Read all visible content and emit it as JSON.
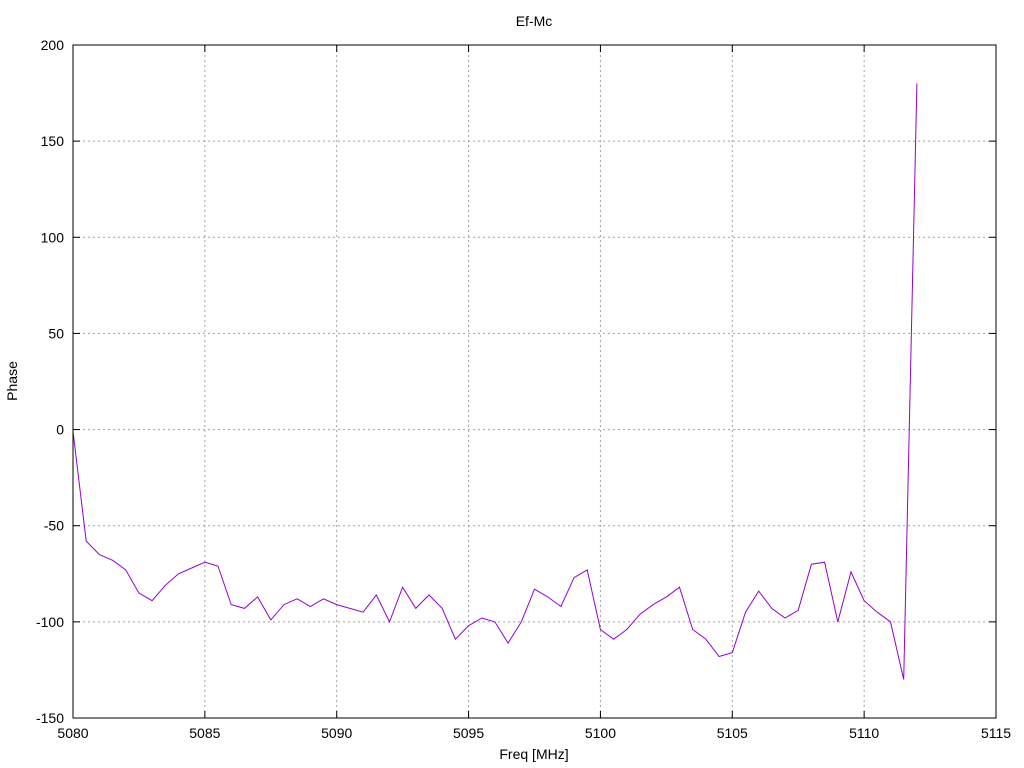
{
  "chart_data": {
    "type": "line",
    "title": "Ef-Mc",
    "xlabel": "Freq [MHz]",
    "ylabel": "Phase",
    "xlim": [
      5080,
      5115
    ],
    "ylim": [
      -150,
      200
    ],
    "xticks": [
      5080,
      5085,
      5090,
      5095,
      5100,
      5105,
      5110,
      5115
    ],
    "yticks": [
      -150,
      -100,
      -50,
      0,
      50,
      100,
      150,
      200
    ],
    "grid": true,
    "series": [
      {
        "color": "#9400d3",
        "x": [
          5080,
          5080.5,
          5081,
          5081.5,
          5082,
          5082.5,
          5083,
          5083.5,
          5084,
          5084.5,
          5085,
          5085.5,
          5086,
          5086.5,
          5087,
          5087.5,
          5088,
          5088.5,
          5089,
          5089.5,
          5090,
          5090.5,
          5091,
          5091.5,
          5092,
          5092.5,
          5093,
          5093.5,
          5094,
          5094.5,
          5095,
          5095.5,
          5096,
          5096.5,
          5097,
          5097.5,
          5098,
          5098.5,
          5099,
          5099.5,
          5100,
          5100.5,
          5101,
          5101.5,
          5102,
          5102.5,
          5103,
          5103.5,
          5104,
          5104.5,
          5105,
          5105.5,
          5106,
          5106.5,
          5107,
          5107.5,
          5108,
          5108.5,
          5109,
          5109.5,
          5110,
          5110.5,
          5111,
          5111.5,
          5112
        ],
        "y": [
          -1,
          -58,
          -65,
          -68,
          -73,
          -85,
          -89,
          -81,
          -75,
          -72,
          -69,
          -71,
          -91,
          -93,
          -87,
          -99,
          -91,
          -88,
          -92,
          -88,
          -91,
          -93,
          -95,
          -86,
          -100,
          -82,
          -93,
          -86,
          -93,
          -109,
          -102,
          -98,
          -100,
          -111,
          -100,
          -83,
          -87,
          -92,
          -77,
          -73,
          -104,
          -109,
          -104,
          -96,
          -91,
          -87,
          -82,
          -104,
          -109,
          -118,
          -116,
          -95,
          -84,
          -93,
          -98,
          -94,
          -70,
          -69,
          -100,
          -74,
          -89,
          -95,
          -100,
          -130,
          180
        ]
      }
    ]
  }
}
